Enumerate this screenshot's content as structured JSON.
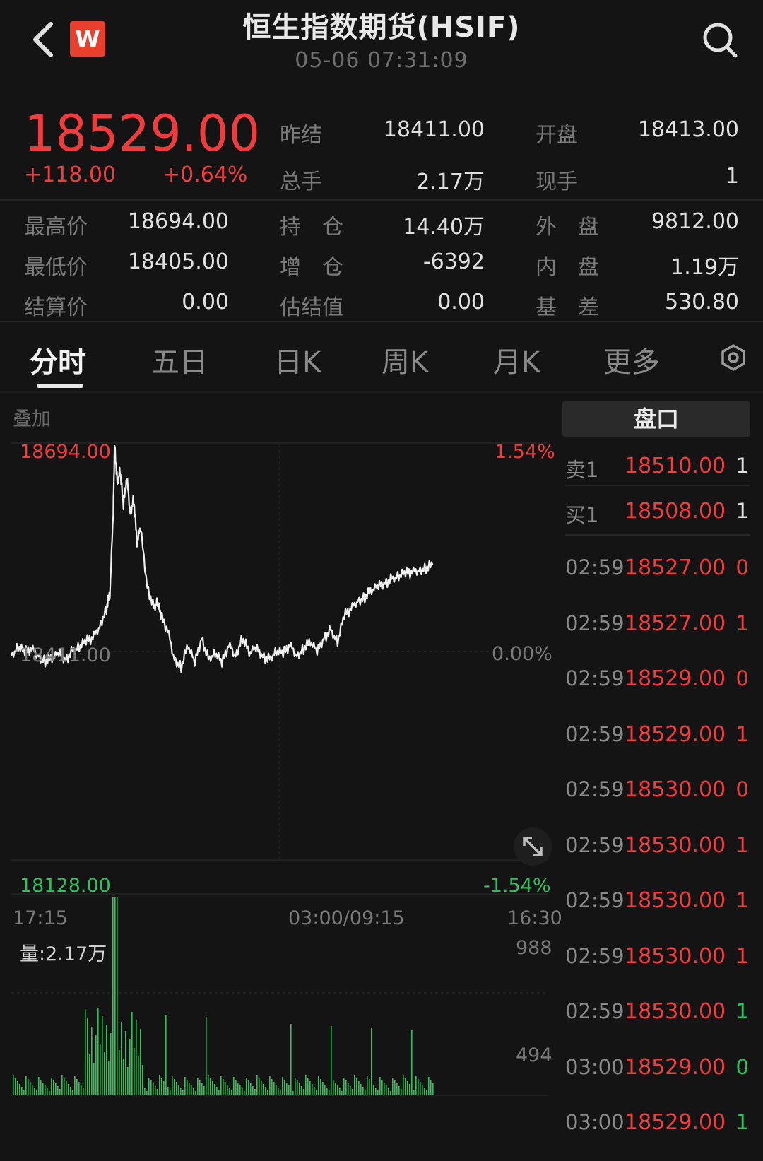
{
  "header": {
    "title": "恒生指数期货(HSIF)",
    "datetime": "05-06 07:31:09",
    "logo_text": "W",
    "back_icon": "chevron-left-icon",
    "search_icon": "search-icon"
  },
  "quote": {
    "price": "18529.00",
    "change": "+118.00",
    "change_pct": "+0.64%",
    "fields": [
      {
        "label": "昨结",
        "value": "18411.00"
      },
      {
        "label": "开盘",
        "value": "18413.00"
      },
      {
        "label": "总手",
        "value": "2.17万"
      },
      {
        "label": "现手",
        "value": "1"
      },
      {
        "label": "最高价",
        "value": "18694.00"
      },
      {
        "label": "持　仓",
        "value": "14.40万"
      },
      {
        "label": "外　盘",
        "value": "9812.00"
      },
      {
        "label": "最低价",
        "value": "18405.00"
      },
      {
        "label": "增　仓",
        "value": "-6392"
      },
      {
        "label": "内　盘",
        "value": "1.19万"
      },
      {
        "label": "结算价",
        "value": "0.00"
      },
      {
        "label": "估结值",
        "value": "0.00"
      },
      {
        "label": "基　差",
        "value": "530.80"
      }
    ]
  },
  "tabs": [
    {
      "label": "分时",
      "active": true
    },
    {
      "label": "五日",
      "active": false
    },
    {
      "label": "日K",
      "active": false
    },
    {
      "label": "周K",
      "active": false
    },
    {
      "label": "月K",
      "active": false
    },
    {
      "label": "更多",
      "active": false
    }
  ],
  "chart": {
    "overlay_label": "叠加",
    "y_max": "18694.00",
    "y_min": "18128.00",
    "y_mid": "18411.00",
    "pct_max": "1.54%",
    "pct_mid": "0.00%",
    "pct_min": "-1.54%",
    "x_start": "17:15",
    "x_mid": "03:00/09:15",
    "x_end": "16:30",
    "volume_label": "量:2.17万",
    "vol_max": "988",
    "vol_mid": "494"
  },
  "chart_data": {
    "type": "line",
    "ylim": [
      18128,
      18694
    ],
    "baseline": 18411,
    "x_progress": [
      0,
      0.01,
      0.02,
      0.03,
      0.04,
      0.05,
      0.06,
      0.07,
      0.08,
      0.09,
      0.1,
      0.11,
      0.12,
      0.13,
      0.14,
      0.145,
      0.15,
      0.152,
      0.156,
      0.16,
      0.165,
      0.17,
      0.175,
      0.18,
      0.185,
      0.19,
      0.2,
      0.21,
      0.215,
      0.22,
      0.23,
      0.24,
      0.25,
      0.26,
      0.27,
      0.28,
      0.29,
      0.3,
      0.31,
      0.32,
      0.33,
      0.34,
      0.35,
      0.36,
      0.37,
      0.38,
      0.39,
      0.4,
      0.41,
      0.42,
      0.43,
      0.44,
      0.45,
      0.46,
      0.47,
      0.48,
      0.49,
      0.5,
      0.51,
      0.52,
      0.53,
      0.54,
      0.55,
      0.56,
      0.57,
      0.58,
      0.59,
      0.6,
      0.61,
      0.62
    ],
    "values": [
      18405,
      18418,
      18410,
      18415,
      18405,
      18398,
      18402,
      18408,
      18400,
      18412,
      18418,
      18425,
      18430,
      18445,
      18470,
      18490,
      18600,
      18694,
      18640,
      18660,
      18610,
      18650,
      18600,
      18620,
      18560,
      18580,
      18500,
      18470,
      18480,
      18460,
      18440,
      18400,
      18390,
      18420,
      18395,
      18430,
      18400,
      18410,
      18395,
      18420,
      18405,
      18430,
      18410,
      18415,
      18405,
      18400,
      18412,
      18408,
      18420,
      18405,
      18415,
      18425,
      18410,
      18430,
      18440,
      18425,
      18460,
      18470,
      18480,
      18485,
      18495,
      18500,
      18505,
      18510,
      18515,
      18518,
      18520,
      18522,
      18525,
      18529
    ],
    "volume_ylim": [
      0,
      988
    ],
    "title": "",
    "xlabel": "",
    "ylabel": ""
  },
  "orderbook": {
    "title": "盘口",
    "levels": [
      {
        "label": "卖1",
        "price": "18510.00",
        "qty": "1"
      },
      {
        "label": "买1",
        "price": "18508.00",
        "qty": "1"
      }
    ],
    "ticks": [
      {
        "time": "02:59",
        "price": "18527.00",
        "qty": "0",
        "qty_color": "#f03c3c"
      },
      {
        "time": "02:59",
        "price": "18527.00",
        "qty": "1",
        "qty_color": "#f03c3c"
      },
      {
        "time": "02:59",
        "price": "18529.00",
        "qty": "0",
        "qty_color": "#f03c3c"
      },
      {
        "time": "02:59",
        "price": "18529.00",
        "qty": "1",
        "qty_color": "#f03c3c"
      },
      {
        "time": "02:59",
        "price": "18530.00",
        "qty": "0",
        "qty_color": "#f03c3c"
      },
      {
        "time": "02:59",
        "price": "18530.00",
        "qty": "1",
        "qty_color": "#f03c3c"
      },
      {
        "time": "02:59",
        "price": "18530.00",
        "qty": "1",
        "qty_color": "#f03c3c"
      },
      {
        "time": "02:59",
        "price": "18530.00",
        "qty": "1",
        "qty_color": "#f03c3c"
      },
      {
        "time": "02:59",
        "price": "18530.00",
        "qty": "1",
        "qty_color": "#2bc35a"
      },
      {
        "time": "03:00",
        "price": "18529.00",
        "qty": "0",
        "qty_color": "#2bc35a"
      },
      {
        "time": "03:00",
        "price": "18529.00",
        "qty": "1",
        "qty_color": "#2bc35a"
      }
    ]
  },
  "colors": {
    "up": "#f03c3c",
    "down": "#2bc35a",
    "background": "#141414"
  }
}
